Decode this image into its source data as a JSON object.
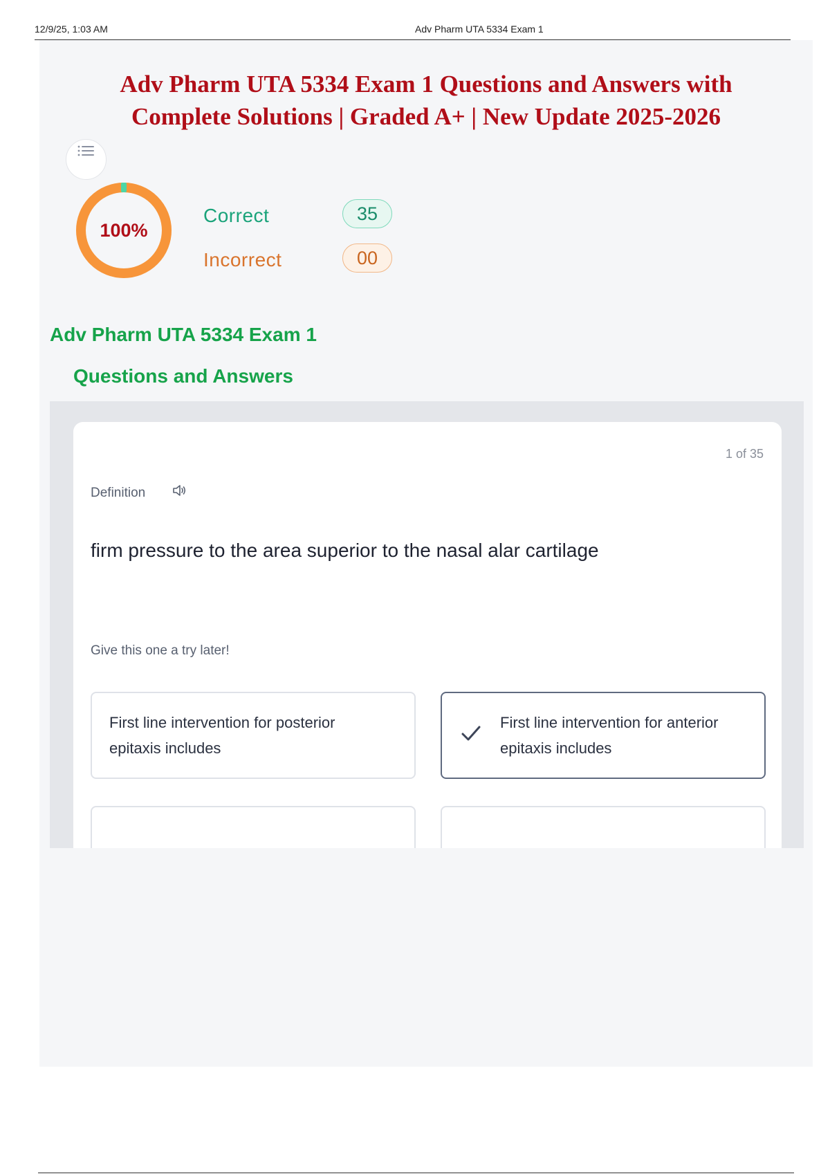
{
  "print_header": {
    "datetime": "12/9/25, 1:03 AM",
    "page_title": "Adv Pharm UTA 5334 Exam 1"
  },
  "document_title": {
    "line1": "Adv Pharm UTA 5334 Exam 1 Questions and Answers with",
    "line2": "Complete Solutions | Graded A+ | New Update 2025-2026"
  },
  "icons": {
    "menu": "list-menu-icon",
    "speaker": "speaker-icon",
    "check": "checkmark-icon"
  },
  "score": {
    "percent_label": "100%",
    "progress_fraction": 1.0,
    "correct_label": "Correct",
    "correct_count": "35",
    "incorrect_label": "Incorrect",
    "incorrect_count": "00"
  },
  "section": {
    "title": "Adv Pharm UTA 5334 Exam 1",
    "subtitle": "Questions and Answers"
  },
  "card": {
    "counter": "1 of 35",
    "definition_label": "Definition",
    "definition_text": "firm pressure to the area superior to the nasal alar cartilage",
    "hint": "Give this one a try later!",
    "options": [
      {
        "text": "First line intervention for posterior epitaxis includes",
        "selected": false
      },
      {
        "text": "First line intervention for anterior epitaxis includes",
        "selected": true
      },
      {
        "text": "",
        "selected": false
      },
      {
        "text": "",
        "selected": false
      }
    ]
  },
  "colors": {
    "title_red": "#b00e18",
    "green": "#16a34a",
    "correct_teal": "#1aa37a",
    "incorrect_orange": "#d9742d",
    "ring_orange": "#f7953a",
    "ring_marker": "#4cd6a6"
  }
}
